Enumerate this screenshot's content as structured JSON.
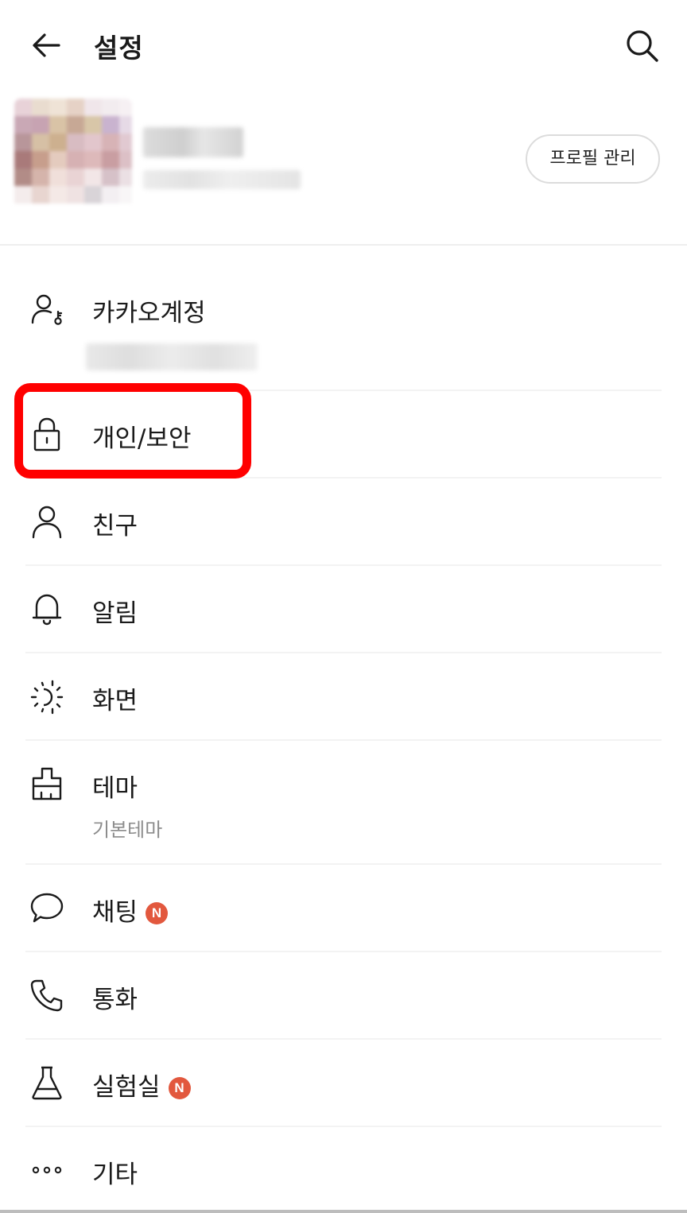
{
  "header": {
    "title": "설정",
    "back_icon": "arrow-left-icon",
    "search_icon": "search-icon"
  },
  "profile": {
    "manage_button_label": "프로필 관리"
  },
  "menu": [
    {
      "id": "kakao-account",
      "label": "카카오계정",
      "icon": "account-key-icon"
    },
    {
      "id": "privacy-security",
      "label": "개인/보안",
      "icon": "lock-icon"
    },
    {
      "id": "friends",
      "label": "친구",
      "icon": "person-icon"
    },
    {
      "id": "notifications",
      "label": "알림",
      "icon": "bell-icon"
    },
    {
      "id": "display",
      "label": "화면",
      "icon": "brightness-icon"
    },
    {
      "id": "theme",
      "label": "테마",
      "sublabel": "기본테마",
      "icon": "paint-brush-icon"
    },
    {
      "id": "chat",
      "label": "채팅",
      "badge": "N",
      "icon": "chat-bubble-icon"
    },
    {
      "id": "call",
      "label": "통화",
      "icon": "phone-icon"
    },
    {
      "id": "lab",
      "label": "실험실",
      "badge": "N",
      "icon": "flask-icon"
    },
    {
      "id": "etc",
      "label": "기타",
      "icon": "more-dots-icon"
    }
  ],
  "colors": {
    "highlight": "#ff0000",
    "badge": "#e2583e",
    "text": "#1a1a1a",
    "sublabel": "#8c8c8c"
  }
}
